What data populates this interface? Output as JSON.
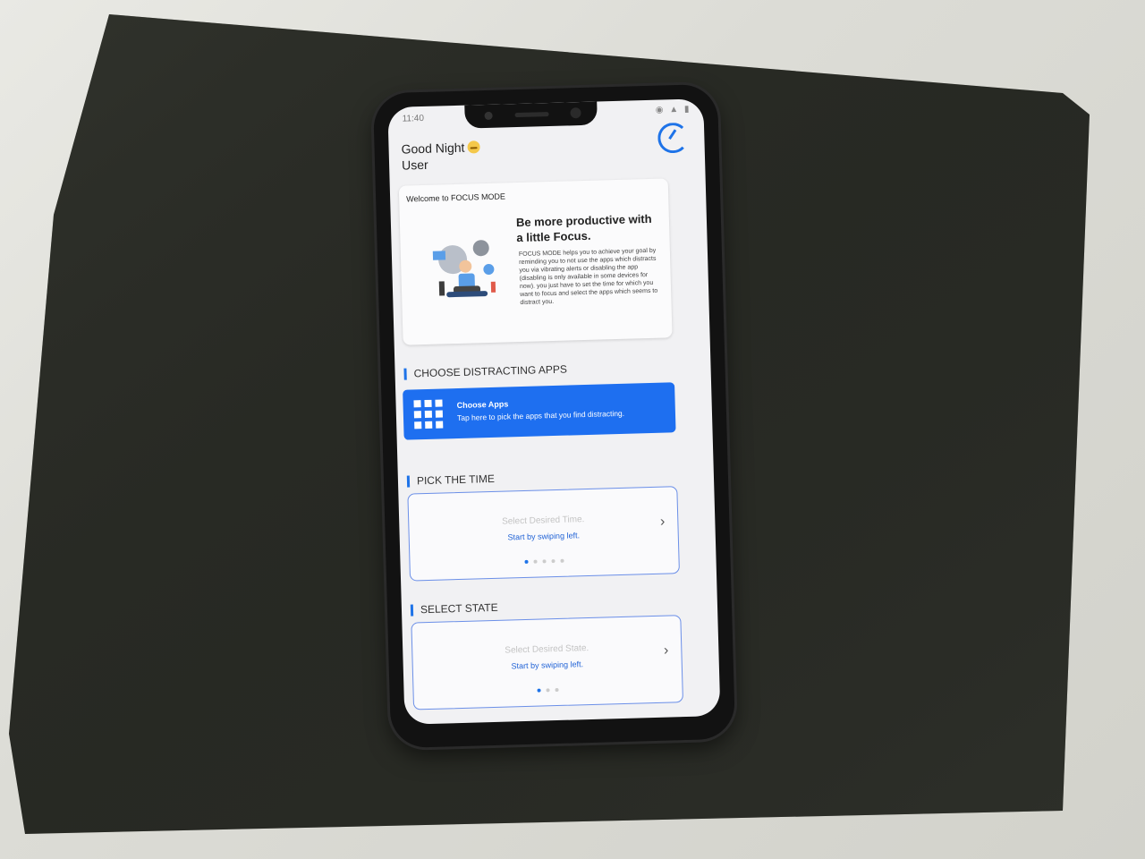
{
  "status": {
    "time": "11:40",
    "icons": "◉ ▲ ▮"
  },
  "greeting": {
    "line1": "Good Night",
    "line2": "User"
  },
  "welcome": {
    "label": "Welcome to FOCUS MODE",
    "headline": "Be more productive with a little Focus.",
    "description": "FOCUS MODE helps you to achieve your goal by reminding you to not use the apps which distracts you via vibrating alerts or disabling the app (disabling is only available in some devices for now). you just have to set the time for which you want to focus and select the apps which seems to distract you."
  },
  "sections": {
    "apps": "CHOOSE DISTRACTING APPS",
    "time": "PICK THE TIME",
    "state": "SELECT STATE"
  },
  "choose_apps": {
    "title": "Choose Apps",
    "subtitle": "Tap here to pick the apps that you find distracting."
  },
  "time_picker": {
    "placeholder": "Select Desired Time.",
    "hint": "Start by swiping left.",
    "page_count": 5,
    "active_page": 1
  },
  "state_picker": {
    "placeholder": "Select Desired State.",
    "hint": "Start by swiping left.",
    "page_count": 3,
    "active_page": 1
  },
  "colors": {
    "accent": "#1e6ff0",
    "mat": "#2b2d27",
    "background": "#e2e2dc"
  }
}
